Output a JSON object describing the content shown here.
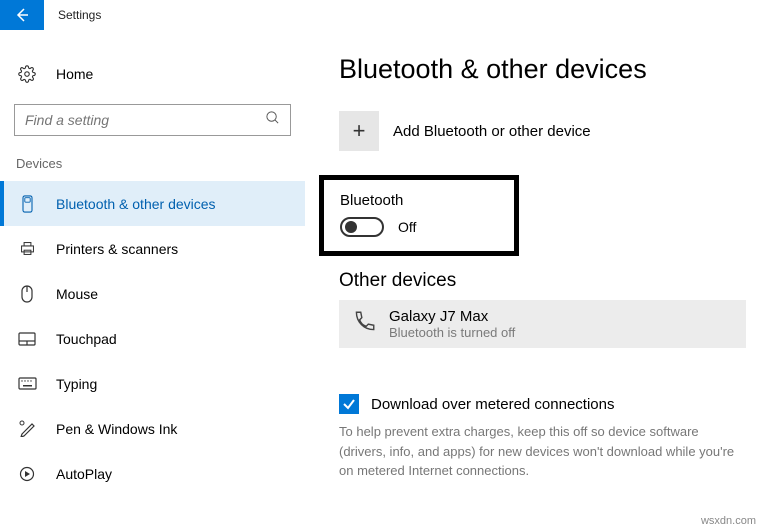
{
  "titlebar": {
    "app": "Settings"
  },
  "sidebar": {
    "home": "Home",
    "search_placeholder": "Find a setting",
    "section": "Devices",
    "items": [
      {
        "label": "Bluetooth & other devices",
        "icon": "bluetooth"
      },
      {
        "label": "Printers & scanners",
        "icon": "printer"
      },
      {
        "label": "Mouse",
        "icon": "mouse"
      },
      {
        "label": "Touchpad",
        "icon": "touchpad"
      },
      {
        "label": "Typing",
        "icon": "keyboard"
      },
      {
        "label": "Pen & Windows Ink",
        "icon": "pen"
      },
      {
        "label": "AutoPlay",
        "icon": "autoplay"
      }
    ]
  },
  "content": {
    "title": "Bluetooth & other devices",
    "add_label": "Add Bluetooth or other device",
    "bt": {
      "label": "Bluetooth",
      "state": "Off"
    },
    "other_hdr": "Other devices",
    "device": {
      "name": "Galaxy J7 Max",
      "status": "Bluetooth is turned off"
    },
    "download_label": "Download over metered connections",
    "help": "To help prevent extra charges, keep this off so device software (drivers, info, and apps) for new devices won't download while you're on metered Internet connections."
  },
  "footer": {
    "credit": "wsxdn.com"
  }
}
